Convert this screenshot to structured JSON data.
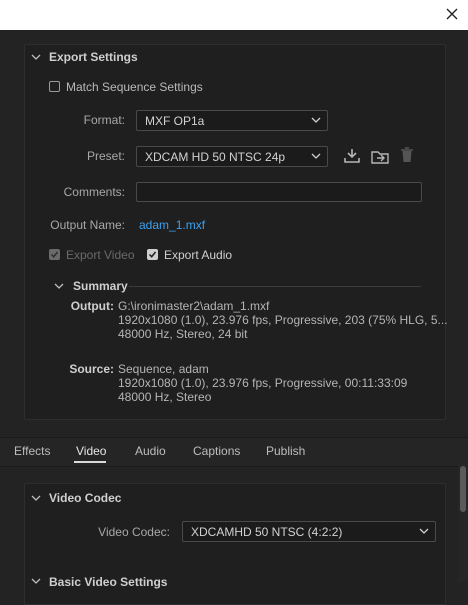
{
  "window": {
    "close_icon": "close-icon"
  },
  "export_settings": {
    "section_title": "Export Settings",
    "match_sequence_label": "Match Sequence Settings",
    "match_sequence_checked": false,
    "format_label": "Format:",
    "format_value": "MXF OP1a",
    "preset_label": "Preset:",
    "preset_value": "XDCAM HD 50 NTSC 24p",
    "comments_label": "Comments:",
    "comments_value": "",
    "output_name_label": "Output Name:",
    "output_name_value": "adam_1.mxf",
    "export_video_label": "Export Video",
    "export_video_checked": true,
    "export_video_disabled": true,
    "export_audio_label": "Export Audio",
    "export_audio_checked": true
  },
  "summary": {
    "title": "Summary",
    "output_key": "Output:",
    "output_lines": [
      "G:\\ironimaster2\\adam_1.mxf",
      "1920x1080 (1.0), 23.976 fps, Progressive, 203 (75% HLG, 5...",
      "48000 Hz, Stereo, 24 bit"
    ],
    "source_key": "Source:",
    "source_lines": [
      "Sequence, adam",
      "1920x1080 (1.0), 23.976 fps, Progressive, 00:11:33:09",
      "48000 Hz, Stereo"
    ]
  },
  "tabs": [
    {
      "label": "Effects",
      "active": false
    },
    {
      "label": "Video",
      "active": true
    },
    {
      "label": "Audio",
      "active": false
    },
    {
      "label": "Captions",
      "active": false
    },
    {
      "label": "Publish",
      "active": false
    }
  ],
  "video_codec": {
    "section_title": "Video Codec",
    "codec_label": "Video Codec:",
    "codec_value": "XDCAMHD 50 NTSC (4:2:2)"
  },
  "next_section_title": "Basic Video Settings",
  "colors": {
    "accent_link": "#3aa1f3",
    "background": "#232323"
  }
}
